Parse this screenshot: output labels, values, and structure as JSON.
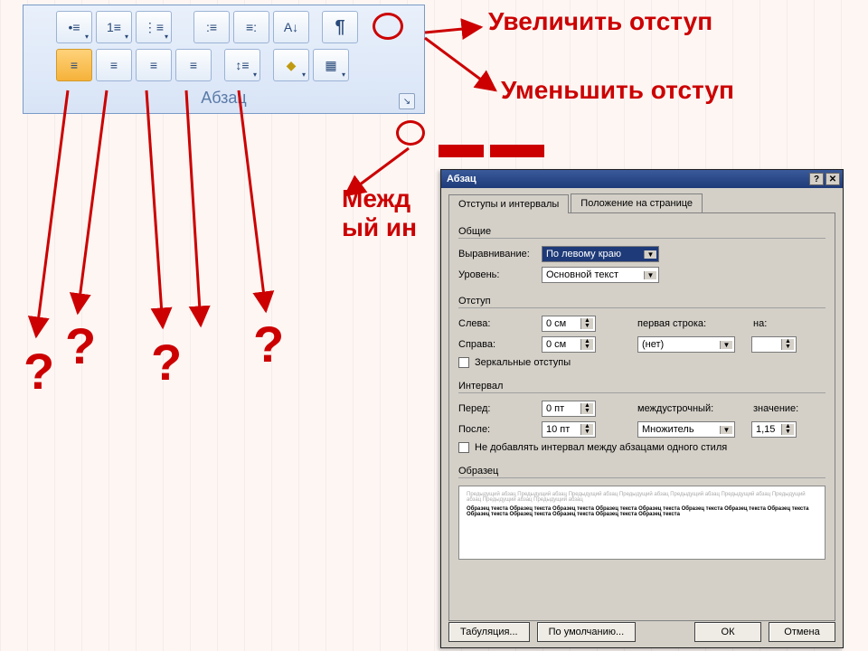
{
  "ribbon": {
    "group_label": "Абзац",
    "row1": {
      "bullets": "•≡",
      "numbering": "1≡",
      "multilevel": "⋮≡",
      "decrease_indent": ":≡",
      "increase_indent": "≡:",
      "sort": "А↓",
      "show_marks": "¶"
    },
    "row2": {
      "align_left": "≡",
      "align_center": "≡",
      "align_right": "≡",
      "justify": "≡",
      "line_spacing": "↕≡",
      "shading": "◆",
      "borders": "▦"
    },
    "launcher": "↘"
  },
  "callouts": {
    "increase": "Увеличить отступ",
    "decrease": "Уменьшить отступ",
    "interline_partial": "Межд\nый ин",
    "q": "?"
  },
  "dialog": {
    "title": "Абзац",
    "help": "?",
    "close": "✕",
    "tabs": {
      "indents": "Отступы и интервалы",
      "position": "Положение на странице"
    },
    "general_hdr": "Общие",
    "alignment_lbl": "Выравнивание:",
    "alignment_val": "По левому краю",
    "level_lbl": "Уровень:",
    "level_val": "Основной текст",
    "indent_hdr": "Отступ",
    "left_lbl": "Слева:",
    "left_val": "0 см",
    "right_lbl": "Справа:",
    "right_val": "0 см",
    "firstline_lbl": "первая строка:",
    "firstline_val": "(нет)",
    "by_lbl": "на:",
    "mirror_chk": "Зеркальные отступы",
    "spacing_hdr": "Интервал",
    "before_lbl": "Перед:",
    "before_val": "0 пт",
    "after_lbl": "После:",
    "after_val": "10 пт",
    "linespace_lbl": "междустрочный:",
    "linespace_val": "Множитель",
    "value_lbl": "значение:",
    "value_val": "1,15",
    "noadd_chk": "Не добавлять интервал между абзацами одного стиля",
    "preview_hdr": "Образец",
    "preview_grey": "Предыдущий абзац Предыдущий абзац Предыдущий абзац Предыдущий абзац Предыдущий абзац Предыдущий абзац Предыдущий абзац Предыдущий абзац Предыдущий абзац",
    "preview_black": "Образец текста Образец текста Образец текста Образец текста Образец текста Образец текста Образец текста Образец текста Образец текста Образец текста Образец текста Образец текста Образец текста",
    "btn_tabs": "Табуляция...",
    "btn_default": "По умолчанию...",
    "btn_ok": "ОК",
    "btn_cancel": "Отмена"
  }
}
